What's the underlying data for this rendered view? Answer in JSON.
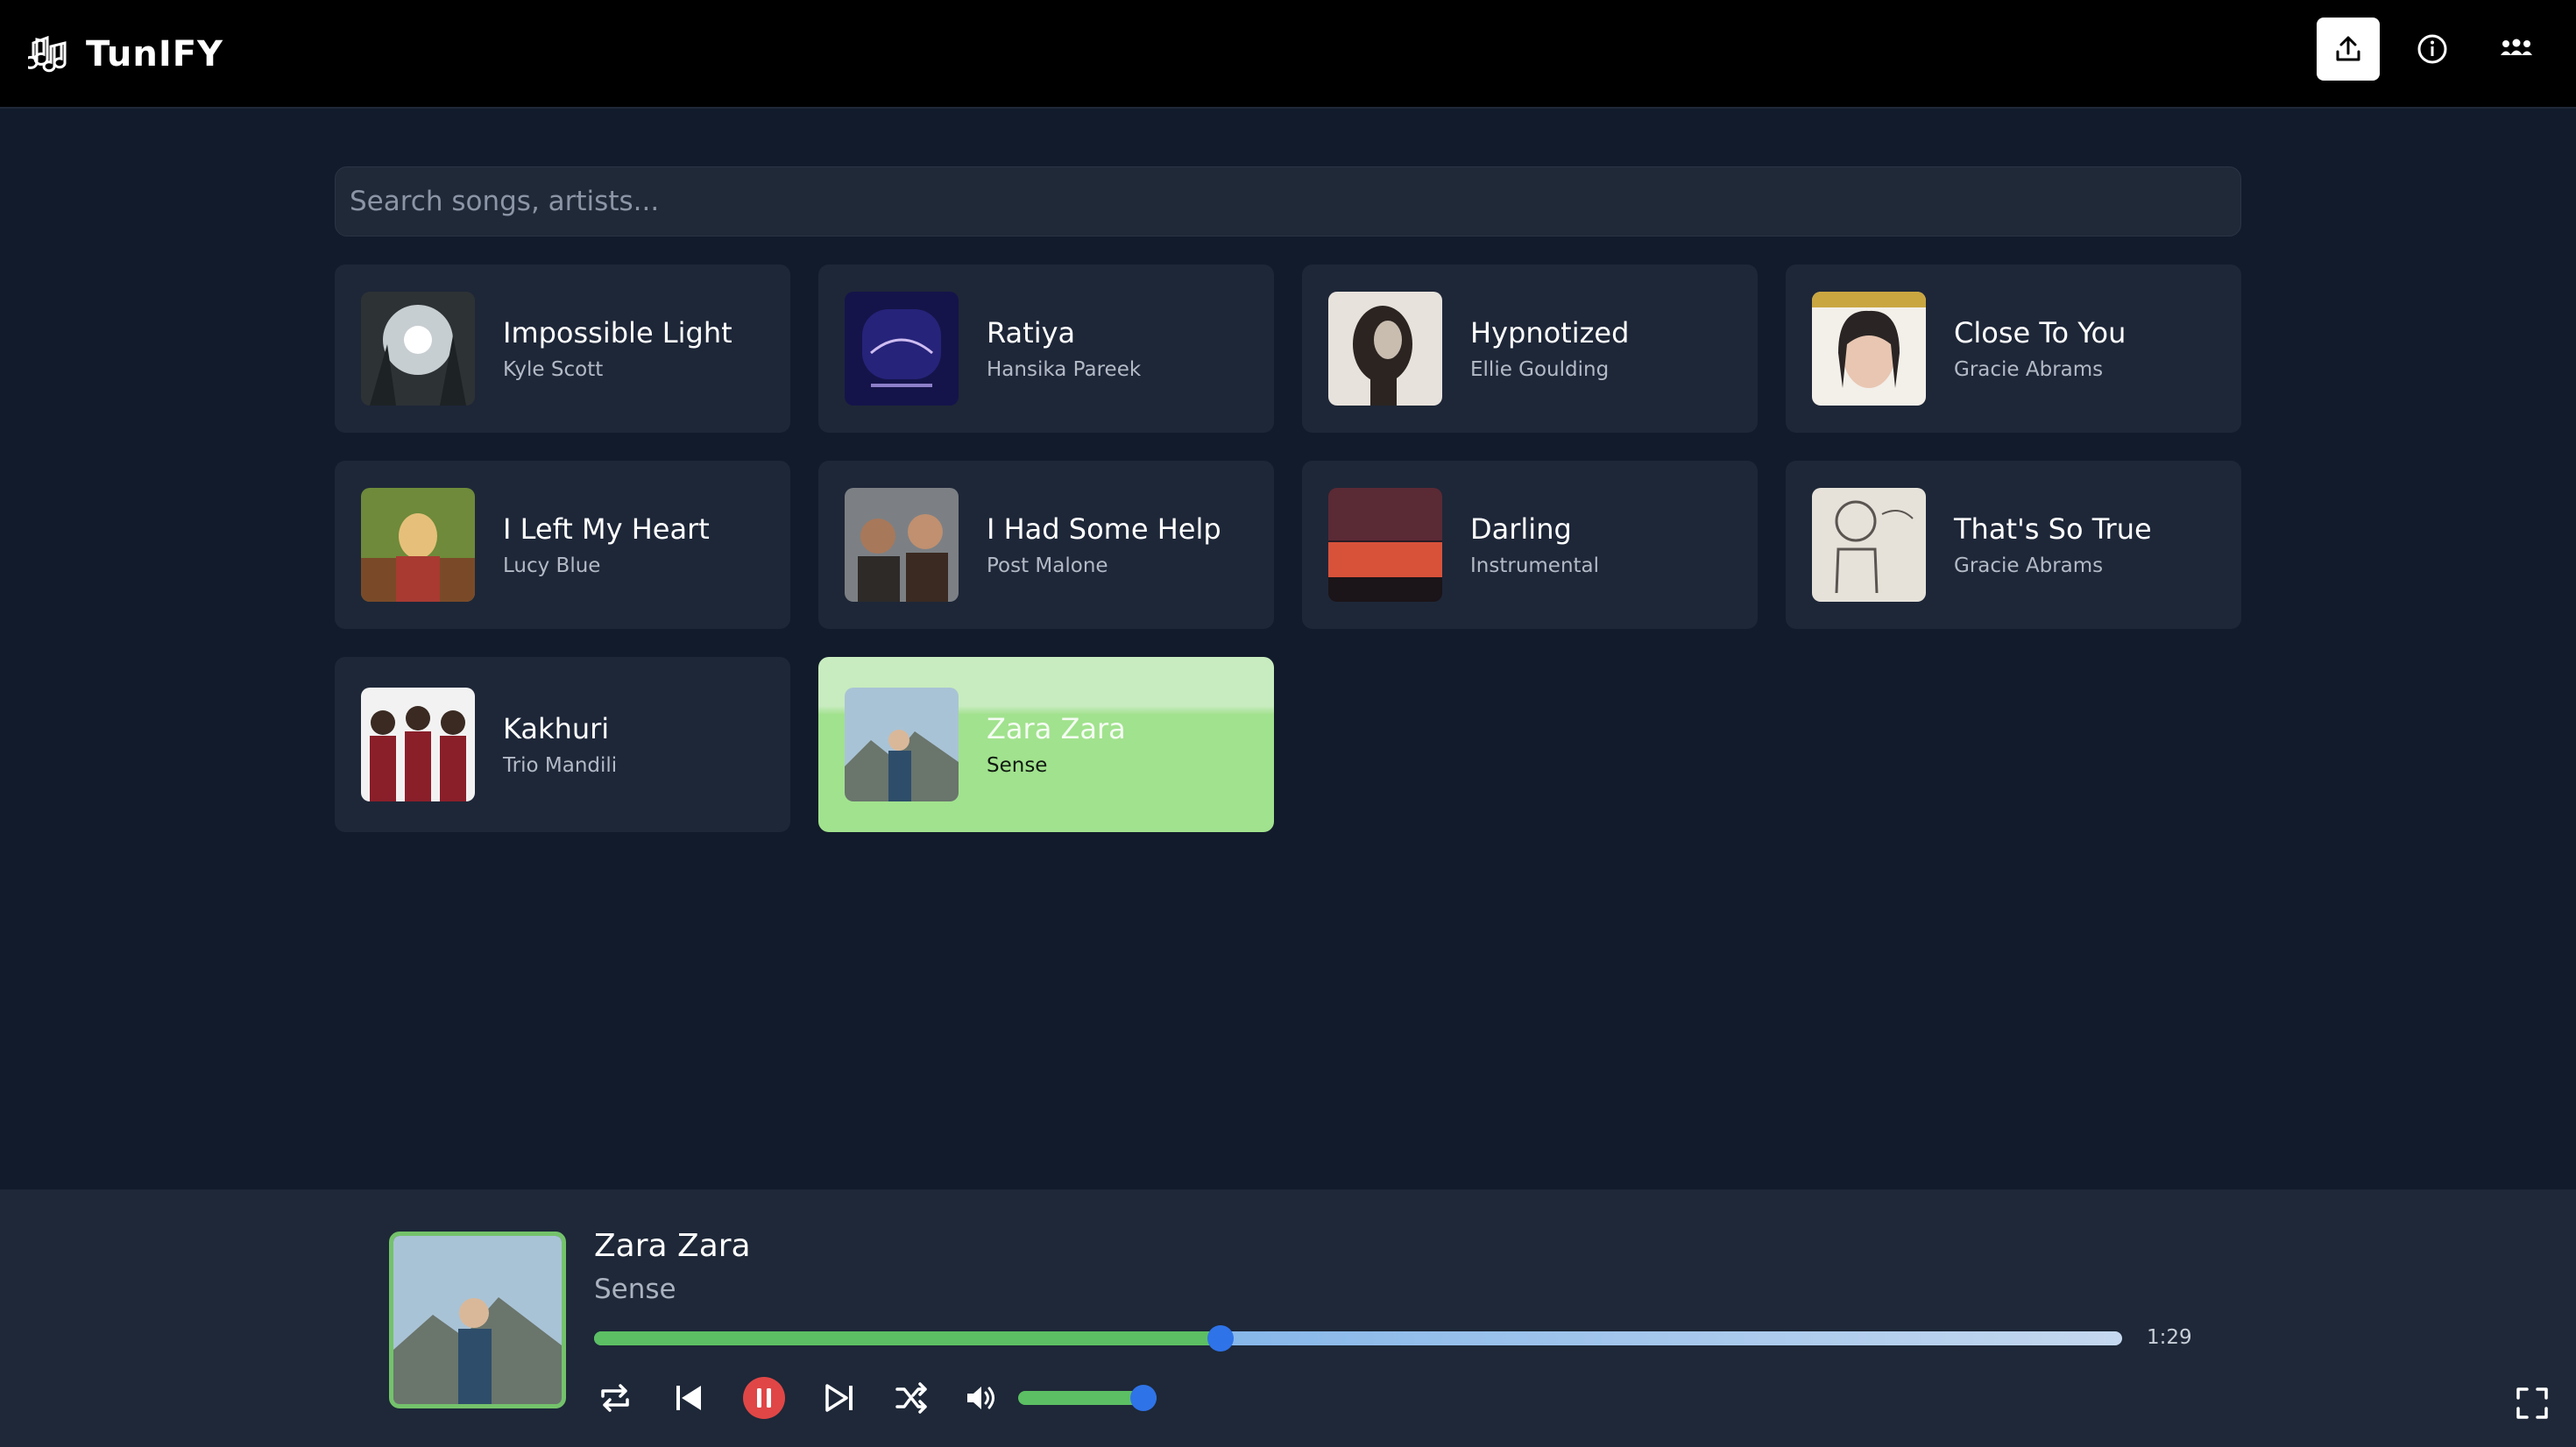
{
  "app": {
    "title": "TunIFY"
  },
  "topbar": {
    "icons": [
      "upload-icon",
      "info-icon",
      "people-icon"
    ]
  },
  "search": {
    "placeholder": "Search songs, artists..."
  },
  "songs": [
    {
      "title": "Impossible Light",
      "artist": "Kyle Scott",
      "art_colors": [
        "#dfe3e6",
        "#3a3f42"
      ]
    },
    {
      "title": "Ratiya",
      "artist": "Hansika Pareek",
      "art_colors": [
        "#1b1a5e",
        "#c0a8e8"
      ]
    },
    {
      "title": "Hypnotized",
      "artist": "Ellie Goulding",
      "art_colors": [
        "#2a2420",
        "#c9bdb0"
      ]
    },
    {
      "title": "Close To You",
      "artist": "Gracie Abrams",
      "art_colors": [
        "#f4f1ec",
        "#2a2524"
      ]
    },
    {
      "title": "I Left My Heart",
      "artist": "Lucy Blue",
      "art_colors": [
        "#6e8a3a",
        "#a83a32"
      ]
    },
    {
      "title": "I Had Some Help",
      "artist": "Post Malone",
      "art_colors": [
        "#6b6f72",
        "#3a2a22"
      ]
    },
    {
      "title": "Darling",
      "artist": "Instrumental",
      "art_colors": [
        "#2b1b25",
        "#d8523a"
      ]
    },
    {
      "title": "That's So True",
      "artist": "Gracie Abrams",
      "art_colors": [
        "#e6e2da",
        "#5a5550"
      ]
    },
    {
      "title": "Kakhuri",
      "artist": "Trio Mandili",
      "art_colors": [
        "#f2f2f2",
        "#8a1f2a"
      ]
    },
    {
      "title": "Zara Zara",
      "artist": "Sense",
      "art_colors": [
        "#a9c3d6",
        "#4d5a4f"
      ],
      "active": true
    }
  ],
  "player": {
    "title": "Zara Zara",
    "artist": "Sense",
    "time": "1:29",
    "progress": 0.41,
    "volume": 0.8,
    "controls": [
      "repeat-icon",
      "previous-icon",
      "pause-icon",
      "next-icon",
      "shuffle-icon",
      "volume-icon"
    ],
    "accent": "#5cbf63",
    "pause_color": "#e04646",
    "thumb_color": "#2f73e8"
  }
}
